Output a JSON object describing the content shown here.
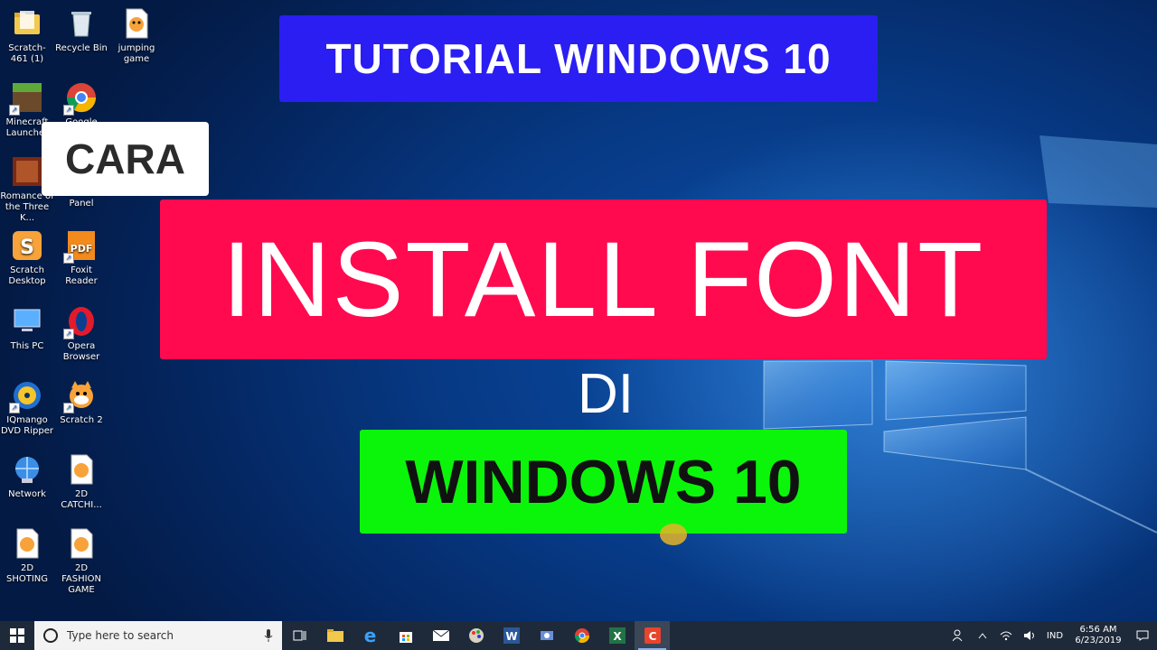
{
  "overlay": {
    "top_banner": "TUTORIAL WINDOWS 10",
    "cara": "CARA",
    "main_title": "INSTALL FONT",
    "di": "DI",
    "windows_label": "WINDOWS 10"
  },
  "desktop_icons": [
    {
      "label": "Scratch-461 (1)",
      "icon": "folder-icon"
    },
    {
      "label": "Recycle Bin",
      "icon": "recycle-bin-icon"
    },
    {
      "label": "jumping game",
      "icon": "scratch-file-icon"
    },
    {
      "label": "Minecraft Launcher",
      "icon": "minecraft-icon"
    },
    {
      "label": "Google Chrome",
      "icon": "chrome-icon"
    },
    {
      "label": "Romance of the Three K...",
      "icon": "game-icon"
    },
    {
      "label": "Control Panel",
      "icon": "control-panel-icon"
    },
    {
      "label": "Scratch Desktop",
      "icon": "scratch-desktop-icon"
    },
    {
      "label": "Foxit Reader",
      "icon": "foxit-icon"
    },
    {
      "label": "This PC",
      "icon": "this-pc-icon"
    },
    {
      "label": "Opera Browser",
      "icon": "opera-icon"
    },
    {
      "label": "IQmango DVD Ripper",
      "icon": "dvd-icon"
    },
    {
      "label": "Scratch 2",
      "icon": "scratch-cat-icon"
    },
    {
      "label": "Network",
      "icon": "network-icon"
    },
    {
      "label": "2D CATCHI...",
      "icon": "scratch-file-icon"
    },
    {
      "label": "2D SHOTING",
      "icon": "scratch-file-icon"
    },
    {
      "label": "2D FASHION GAME",
      "icon": "scratch-file-icon"
    }
  ],
  "taskbar": {
    "search_placeholder": "Type here to search",
    "apps": [
      "task-view-icon",
      "file-explorer-icon",
      "edge-icon",
      "store-icon",
      "mail-icon",
      "paint-icon",
      "word-icon",
      "app-icon",
      "chrome-icon",
      "excel-icon",
      "camtasia-icon"
    ],
    "language": "IND",
    "time": "6:56 AM",
    "date": "6/23/2019"
  },
  "colors": {
    "top_banner_bg": "#2a1ef2",
    "main_banner_bg": "#ff0a4f",
    "green_banner_bg": "#0bf50b",
    "taskbar_bg": "#1e2a3a"
  }
}
